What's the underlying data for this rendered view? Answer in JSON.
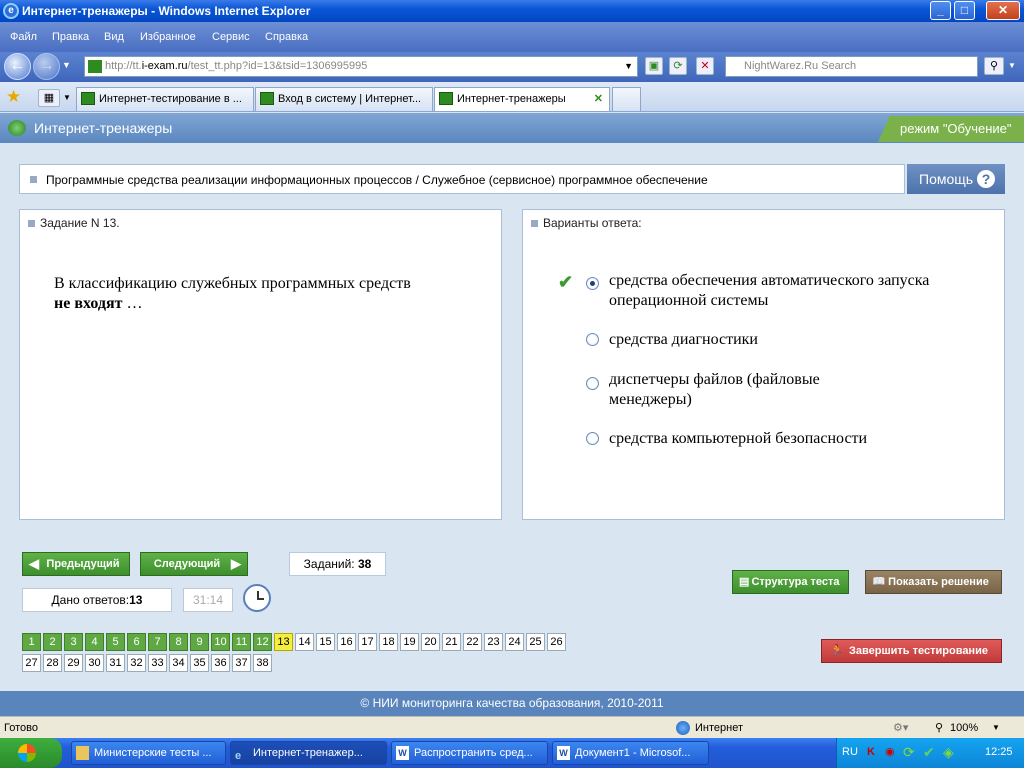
{
  "window": {
    "title": "Интернет-тренажеры - Windows Internet Explorer",
    "min": "_",
    "max": "□",
    "close": "✕"
  },
  "menu": [
    "Файл",
    "Правка",
    "Вид",
    "Избранное",
    "Сервис",
    "Справка"
  ],
  "nav": {
    "url_prefix": "http://tt.",
    "url_domain": "i-exam.ru",
    "url_rest": "/test_tt.php?id=13&tsid=1306995995",
    "search_placeholder": "NightWarez.Ru Search"
  },
  "tabs": [
    {
      "label": "Интернет-тестирование в ...",
      "active": false
    },
    {
      "label": "Вход в систему | Интернет...",
      "active": false
    },
    {
      "label": "Интернет-тренажеры",
      "active": true
    }
  ],
  "app": {
    "title": "Интернет-тренажеры",
    "mode": "режим \"Обучение\""
  },
  "path_text": "Программные средства реализации информационных процессов / Служебное (сервисное) программное обеспечение",
  "help_label": "Помощь",
  "question": {
    "header": "Задание N 13.",
    "text_plain": "В классификацию служебных программных средств",
    "text_bold": "не входят",
    "text_tail": " …"
  },
  "answers": {
    "header": "Варианты ответа:",
    "options": [
      {
        "text": "средства обеспечения автоматического запуска операционной системы",
        "selected": true,
        "correct": true
      },
      {
        "text": "средства диагностики",
        "selected": false
      },
      {
        "text": "диспетчеры файлов (файловые менеджеры)",
        "selected": false
      },
      {
        "text": "средства компьютерной безопасности",
        "selected": false
      }
    ]
  },
  "controls": {
    "prev": "Предыдущий",
    "next": "Следующий",
    "tasks_label": "Заданий:",
    "tasks_count": "38",
    "answered_label": "Дано ответов:",
    "answered_count": "13",
    "timer": "31:14",
    "structure": "Структура теста",
    "show_solution": "Показать решение",
    "finish": "Завершить тестирование"
  },
  "task_numbers": {
    "total": 38,
    "answered_upto": 12,
    "current": 13
  },
  "footer": "© НИИ мониторинга качества образования, 2010-2011",
  "status": {
    "left": "Готово",
    "zone": "Интернет",
    "zoom": "100%"
  },
  "taskbar": {
    "items": [
      {
        "label": "Министерские тесты ...",
        "active": false
      },
      {
        "label": "Интернет-тренажер...",
        "active": true
      },
      {
        "label": "Распространить сред...",
        "active": false
      },
      {
        "label": "Документ1 - Microsof...",
        "active": false
      }
    ],
    "lang": "RU",
    "clock": "12:25"
  },
  "colors": {
    "accent_green": "#5fa844",
    "current_yellow": "#f5ee3c",
    "finish_red": "#d64a4a",
    "solution_brown": "#8a7456"
  }
}
